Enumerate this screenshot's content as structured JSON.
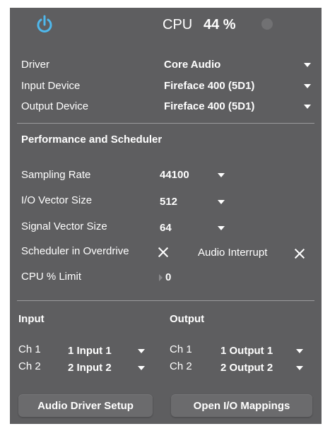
{
  "header": {
    "power_icon": "power-icon",
    "accent_color": "#4fb8ec",
    "cpu_label": "CPU",
    "cpu_value": "44 %"
  },
  "driver": {
    "driver_label": "Driver",
    "driver_value": "Core Audio",
    "input_device_label": "Input Device",
    "input_device_value": "Fireface 400 (5D1)",
    "output_device_label": "Output Device",
    "output_device_value": "Fireface 400 (5D1)"
  },
  "performance": {
    "section_title": "Performance and Scheduler",
    "sampling_rate_label": "Sampling Rate",
    "sampling_rate_value": "44100",
    "io_vector_label": "I/O Vector Size",
    "io_vector_value": "512",
    "signal_vector_label": "Signal Vector Size",
    "signal_vector_value": "64",
    "overdrive_label": "Scheduler in Overdrive",
    "audio_interrupt_label": "Audio Interrupt",
    "cpu_limit_label": "CPU % Limit",
    "cpu_limit_value": "0"
  },
  "io": {
    "input_title": "Input",
    "output_title": "Output",
    "in_ch1_label": "Ch 1",
    "in_ch1_value": "1 Input 1",
    "in_ch2_label": "Ch 2",
    "in_ch2_value": "2 Input 2",
    "out_ch1_label": "Ch 1",
    "out_ch1_value": "1 Output 1",
    "out_ch2_label": "Ch 2",
    "out_ch2_value": "2 Output 2"
  },
  "buttons": {
    "driver_setup": "Audio Driver Setup",
    "io_mappings": "Open I/O Mappings"
  }
}
